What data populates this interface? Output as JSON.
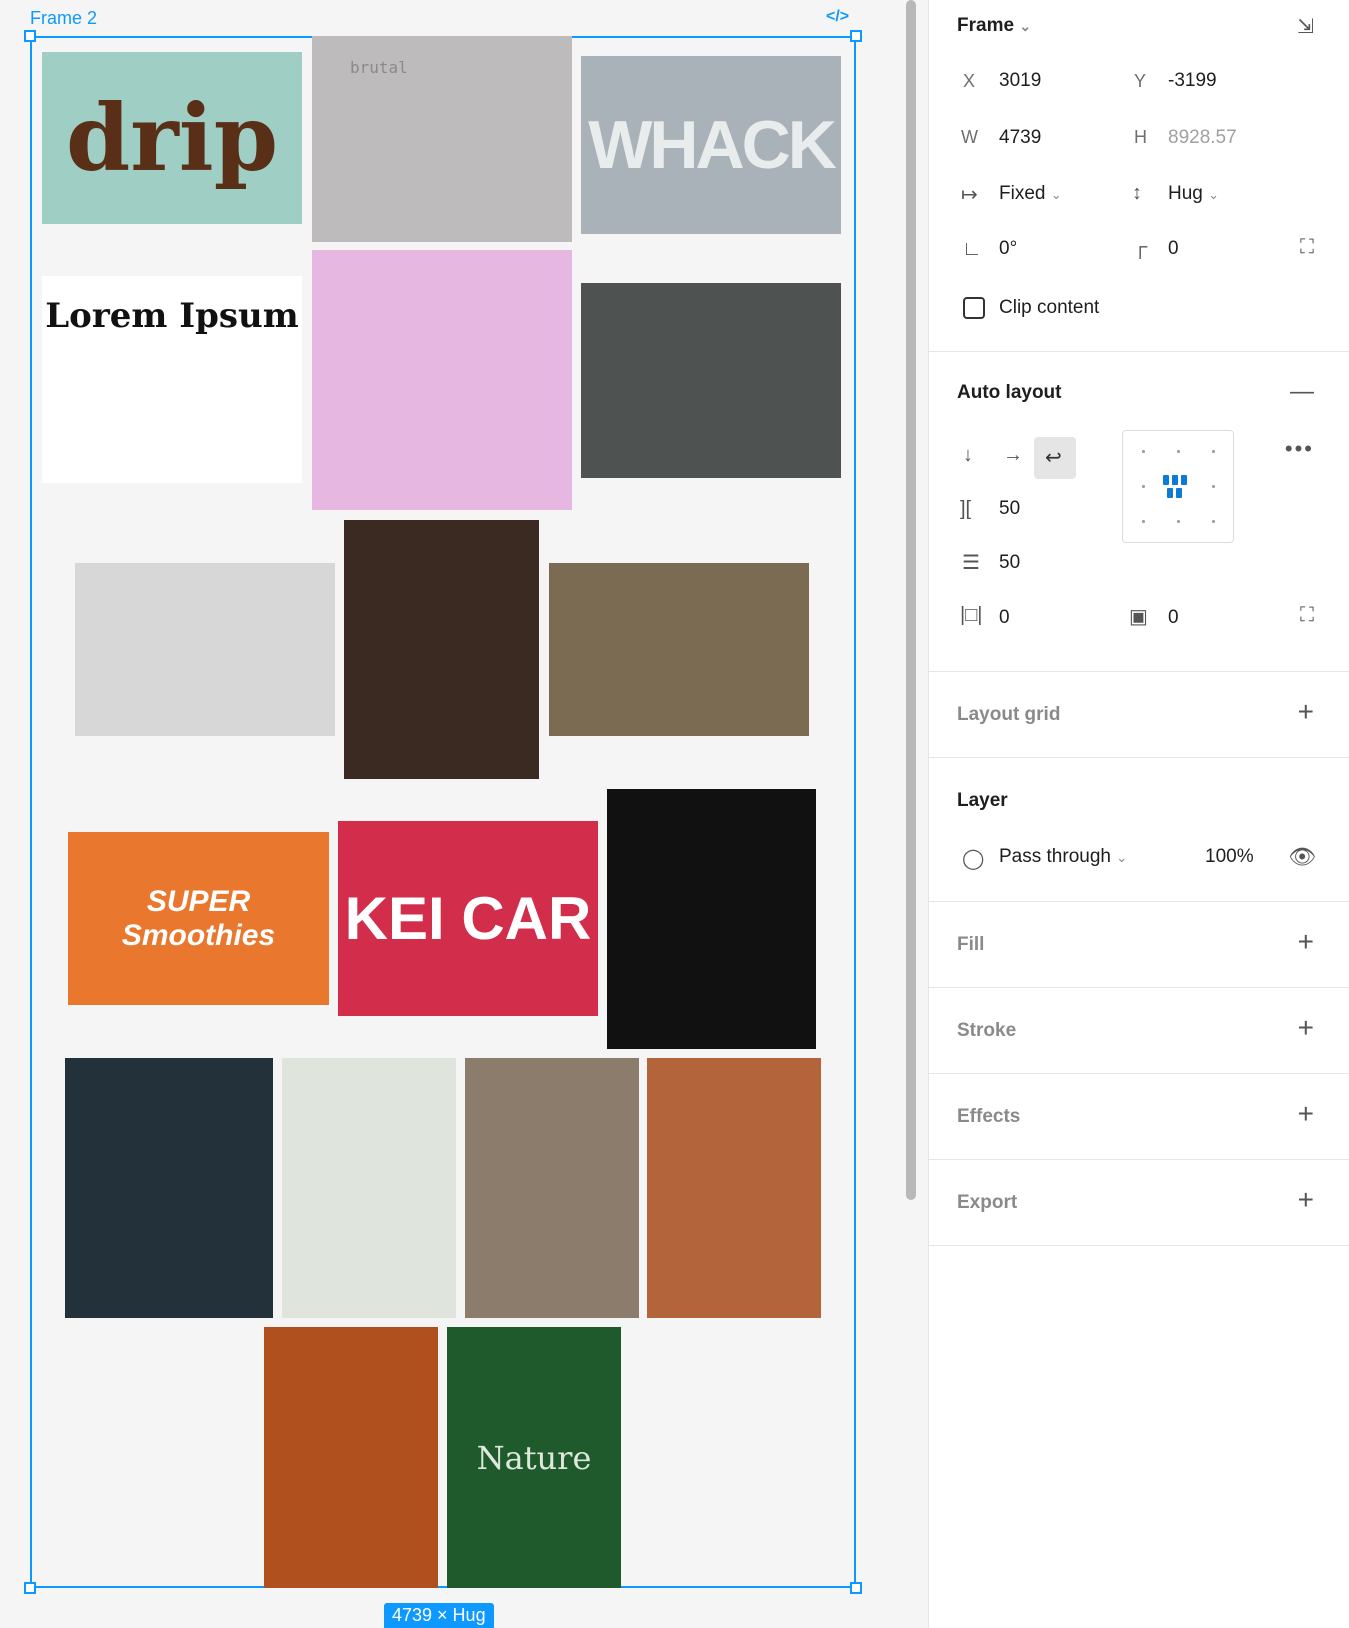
{
  "canvas": {
    "frame_label": "Frame 2",
    "size_badge": "4739 × Hug",
    "code_icon": "code-icon",
    "tiles": [
      {
        "name": "drip",
        "text": "drip",
        "bg": "#9fcfc4",
        "fg": "#5a2f18"
      },
      {
        "name": "brutal",
        "text": "brutal",
        "bg": "#bdbbbb",
        "fg": "#8a8a8a"
      },
      {
        "name": "whack",
        "text": "WHACK",
        "bg": "#a9b2b8",
        "fg": "#e9ecec"
      },
      {
        "name": "lorem-ipsum",
        "text": "Lorem Ipsum",
        "bg": "#ffffff",
        "fg": "#111111"
      },
      {
        "name": "syr",
        "text": "",
        "bg": "#e6b8e1",
        "fg": "#2e8a6e"
      },
      {
        "name": "misty-forest",
        "text": "",
        "bg": "#4e5250",
        "fg": "#ffffff"
      },
      {
        "name": "silhouette-building",
        "text": "",
        "bg": "#d7d7d7",
        "fg": "#ffffff"
      },
      {
        "name": "bus-stop",
        "text": "",
        "bg": "#3b2a21",
        "fg": "#ffffff"
      },
      {
        "name": "cabin",
        "text": "",
        "bg": "#7a6b52",
        "fg": "#ffffff"
      },
      {
        "name": "smoothies",
        "text": "SUPER Smoothies",
        "bg": "#e9772d",
        "fg": "#ffffff"
      },
      {
        "name": "kei-car",
        "text": "KEI CAR",
        "bg": "#d22d4b",
        "fg": "#ffffff"
      },
      {
        "name": "hand-portrait",
        "text": "",
        "bg": "#111111",
        "fg": "#ffffff"
      },
      {
        "name": "dark-city",
        "text": "",
        "bg": "#22313a",
        "fg": "#ffffff"
      },
      {
        "name": "sunglasses-portrait",
        "text": "",
        "bg": "#dfe5dc",
        "fg": "#ffffff"
      },
      {
        "name": "old-car",
        "text": "",
        "bg": "#8b7c6b",
        "fg": "#ffffff"
      },
      {
        "name": "brick-wall-portrait",
        "text": "",
        "bg": "#b4643a",
        "fg": "#ffffff"
      },
      {
        "name": "glitch-portrait",
        "text": "",
        "bg": "#b0501f",
        "fg": "#ffffff"
      },
      {
        "name": "nature",
        "text": "Nature",
        "bg": "#1f5a2c",
        "fg": "#dfe8dc"
      }
    ]
  },
  "panel": {
    "frame": {
      "title": "Frame",
      "x_label": "X",
      "x_value": "3019",
      "y_label": "Y",
      "y_value": "-3199",
      "w_label": "W",
      "w_value": "4739",
      "h_label": "H",
      "h_value": "8928.57",
      "width_mode": "Fixed",
      "height_mode": "Hug",
      "rotation": "0°",
      "radius": "0",
      "clip_label": "Clip content"
    },
    "auto_layout": {
      "title": "Auto layout",
      "gap_horizontal": "50",
      "gap_vertical": "50",
      "padding_horizontal": "0",
      "padding_vertical": "0"
    },
    "layout_grid": {
      "title": "Layout grid"
    },
    "layer": {
      "title": "Layer",
      "blend": "Pass through",
      "opacity": "100%"
    },
    "fill": {
      "title": "Fill"
    },
    "stroke": {
      "title": "Stroke"
    },
    "effects": {
      "title": "Effects"
    },
    "export": {
      "title": "Export"
    }
  }
}
